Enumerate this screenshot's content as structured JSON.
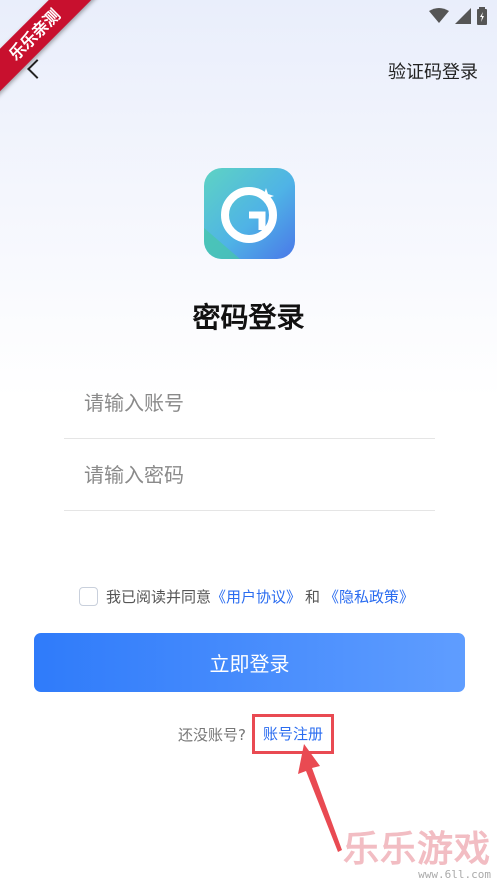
{
  "watermark": {
    "corner_text": "乐乐亲测",
    "brand_text": "乐乐游戏",
    "url": "www.6ll.com"
  },
  "header": {
    "sms_login_label": "验证码登录"
  },
  "page": {
    "title": "密码登录"
  },
  "form": {
    "account_placeholder": "请输入账号",
    "account_value": "",
    "password_placeholder": "请输入密码",
    "password_value": ""
  },
  "agreement": {
    "prefix": "我已阅读并同意",
    "user_agreement": "《用户协议》",
    "conjunction": "和",
    "privacy_policy": "《隐私政策》",
    "checked": false
  },
  "actions": {
    "login_label": "立即登录",
    "register_prompt": "还没账号?",
    "register_label": "账号注册"
  },
  "colors": {
    "accent": "#2f7bfa",
    "link": "#2a6cf0",
    "highlight_box": "#e94a52",
    "ribbon": "#c8102e"
  }
}
